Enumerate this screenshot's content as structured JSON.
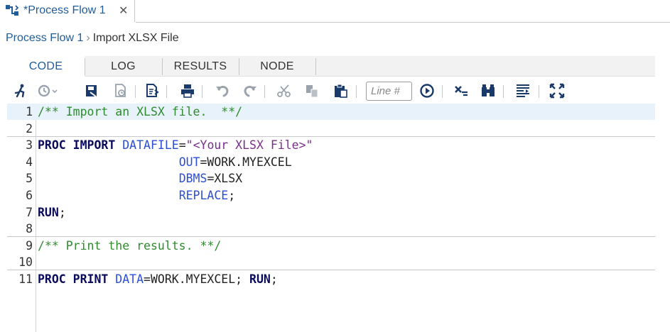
{
  "doc_tab": {
    "title": "*Process Flow 1",
    "close_glyph": "✕",
    "icon": "process-flow-icon"
  },
  "breadcrumb": {
    "items": [
      "Process Flow 1",
      "Import XLSX File"
    ],
    "separator": "›"
  },
  "view_tabs": [
    {
      "label": "CODE",
      "active": true
    },
    {
      "label": "LOG",
      "active": false
    },
    {
      "label": "RESULTS",
      "active": false
    },
    {
      "label": "NODE",
      "active": false
    }
  ],
  "toolbar": {
    "line_number_placeholder": "Line #",
    "buttons": [
      "run-icon",
      "history-icon",
      "save-icon",
      "save-as-icon",
      "format-code-icon",
      "print-icon",
      "undo-icon",
      "redo-icon",
      "cut-icon",
      "copy-icon",
      "paste-icon",
      "go-to-line-icon",
      "clear-code-icon",
      "find-replace-icon",
      "snippets-icon",
      "maximize-icon"
    ]
  },
  "editor": {
    "lines": [
      {
        "n": "1",
        "tokens": [
          {
            "t": "/** Import an XLSX file.  **/",
            "c": "cm"
          }
        ]
      },
      {
        "n": "2",
        "tokens": []
      },
      {
        "n": "3",
        "tokens": [
          {
            "t": "PROC IMPORT",
            "c": "kw"
          },
          {
            "t": " ",
            "c": "plain"
          },
          {
            "t": "DATAFILE",
            "c": "opt"
          },
          {
            "t": "=",
            "c": "plain"
          },
          {
            "t": "\"<Your XLSX File>\"",
            "c": "str"
          }
        ]
      },
      {
        "n": "4",
        "tokens": [
          {
            "t": "                    ",
            "c": "plain"
          },
          {
            "t": "OUT",
            "c": "opt"
          },
          {
            "t": "=WORK.MYEXCEL",
            "c": "plain"
          }
        ]
      },
      {
        "n": "5",
        "tokens": [
          {
            "t": "                    ",
            "c": "plain"
          },
          {
            "t": "DBMS",
            "c": "opt"
          },
          {
            "t": "=XLSX",
            "c": "plain"
          }
        ]
      },
      {
        "n": "6",
        "tokens": [
          {
            "t": "                    ",
            "c": "plain"
          },
          {
            "t": "REPLACE",
            "c": "opt"
          },
          {
            "t": ";",
            "c": "plain"
          }
        ]
      },
      {
        "n": "7",
        "tokens": [
          {
            "t": "RUN",
            "c": "kw"
          },
          {
            "t": ";",
            "c": "plain"
          }
        ]
      },
      {
        "n": "8",
        "tokens": []
      },
      {
        "n": "9",
        "tokens": [
          {
            "t": "/** Print the results. **/",
            "c": "cm"
          }
        ]
      },
      {
        "n": "10",
        "tokens": []
      },
      {
        "n": "11",
        "tokens": [
          {
            "t": "PROC PRINT",
            "c": "kw"
          },
          {
            "t": " ",
            "c": "plain"
          },
          {
            "t": "DATA",
            "c": "opt"
          },
          {
            "t": "=WORK.MYEXCEL; ",
            "c": "plain"
          },
          {
            "t": "RUN",
            "c": "kw"
          },
          {
            "t": ";",
            "c": "plain"
          }
        ]
      }
    ],
    "current_line": "1",
    "statement_separators_after": [
      "2",
      "8",
      "10"
    ]
  },
  "colors": {
    "accent": "#1f5c99",
    "comment": "#2e8b2e",
    "keyword": "#0a0a5c",
    "option": "#2b4fd4",
    "string": "#7a2f8c"
  }
}
